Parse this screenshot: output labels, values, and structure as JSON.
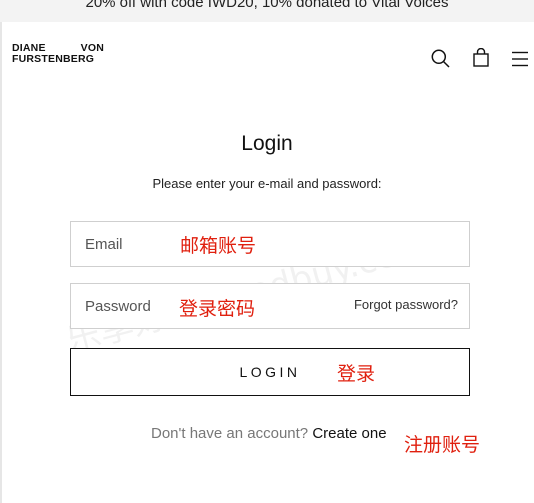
{
  "promo": {
    "text": "20% off with code IWD20, 10% donated to Vital Voices"
  },
  "logo": {
    "line1_left": "DIANE",
    "line1_right": "VON",
    "line2": "FURSTENBERG"
  },
  "header": {
    "icons": [
      "search-icon",
      "bag-icon",
      "menu-icon"
    ]
  },
  "login": {
    "title": "Login",
    "subtitle": "Please enter your e-mail and password:",
    "email_placeholder": "Email",
    "password_placeholder": "Password",
    "forgot_label": "Forgot password?",
    "button_label": "LOGIN",
    "signup_prompt": "Don't have an account?",
    "signup_link": "Create one"
  },
  "annotations": {
    "email_note": "邮箱账号",
    "password_note": "登录密码",
    "login_note": "登录",
    "signup_note": "注册账号"
  },
  "watermark": {
    "text": "乐享好物 goodbuy.com"
  },
  "colors": {
    "annotation": "#e0200f",
    "border": "#cfcfcf",
    "promo_bg": "#f3f3f3"
  }
}
